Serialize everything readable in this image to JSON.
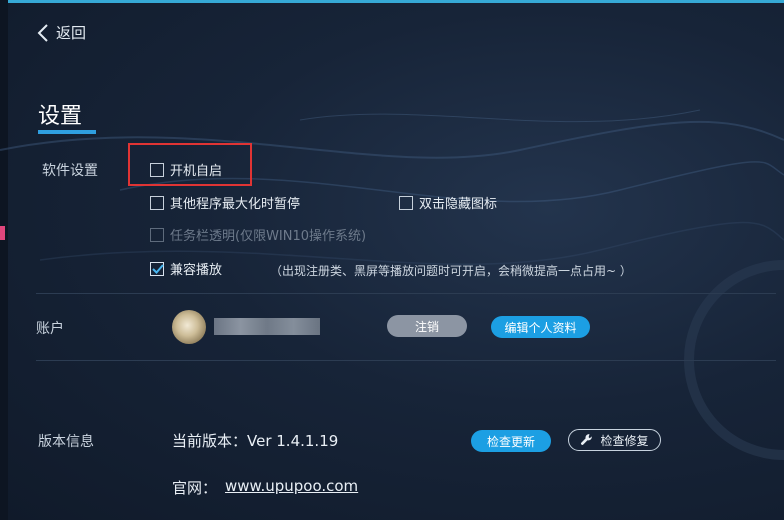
{
  "header": {
    "back_label": "返回",
    "title": "设置"
  },
  "software_settings": {
    "label": "软件设置",
    "options": [
      {
        "label": "开机自启",
        "checked": false,
        "disabled": false
      },
      {
        "label": "其他程序最大化时暂停",
        "checked": false,
        "disabled": false
      },
      {
        "label": "双击隐藏图标",
        "checked": false,
        "disabled": false
      },
      {
        "label": "任务栏透明(仅限WIN10操作系统)",
        "checked": false,
        "disabled": true
      },
      {
        "label": "兼容播放",
        "checked": true,
        "disabled": false
      }
    ],
    "compat_note": "（出现注册类、黑屏等播放问题时可开启，会稍微提高一点占用~ ）"
  },
  "account": {
    "label": "账户",
    "logout_label": "注销",
    "edit_profile_label": "编辑个人资料"
  },
  "version_info": {
    "label": "版本信息",
    "current_version_text": "当前版本：Ver 1.4.1.19",
    "check_update_label": "检查更新",
    "check_repair_label": "检查修复",
    "site_label": "官网：",
    "site_url": "www.upupoo.com"
  },
  "colors": {
    "accent": "#1c9fe3",
    "highlight_box": "#e03434",
    "background": "#172438"
  }
}
